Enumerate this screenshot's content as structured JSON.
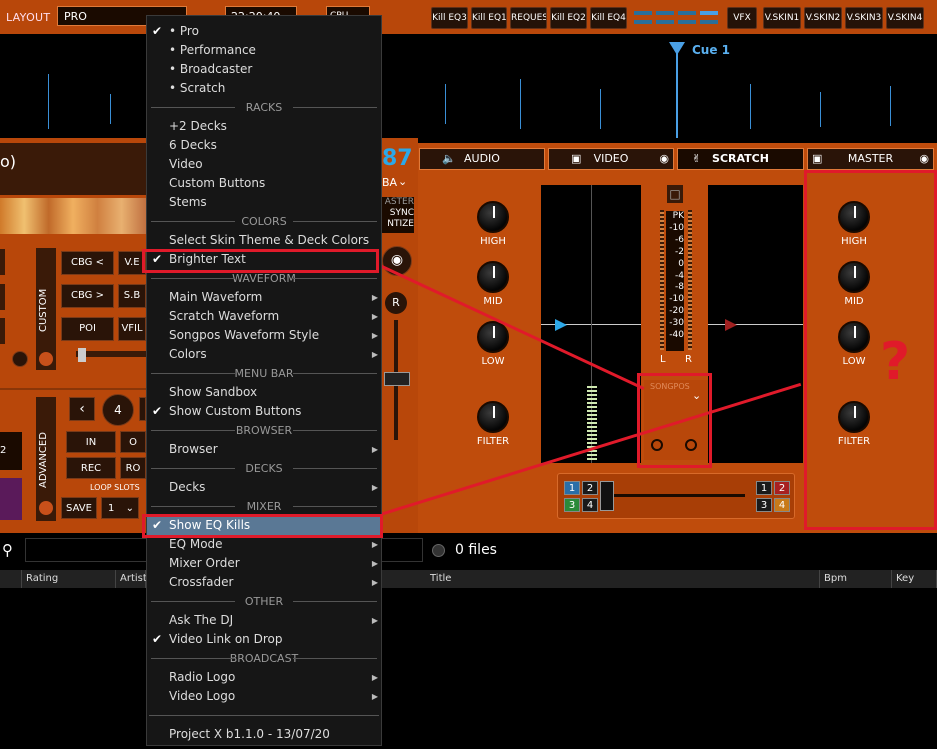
{
  "topbar": {
    "layout_label": "LAYOUT",
    "layout_value": "PRO",
    "clock": "22:20:40",
    "cpu_label": "CPU",
    "buttons": [
      "Kill EQ3",
      "Kill EQ1",
      "REQUEST",
      "Kill EQ2",
      "Kill EQ4",
      "VFX",
      "V.SKIN1",
      "V.SKIN2",
      "V.SKIN3",
      "V.SKIN4"
    ]
  },
  "waveform": {
    "cue_label": "Cue 1"
  },
  "deck": {
    "title_fragment": "o)",
    "bpm_fragment": "87",
    "key_fragment": "BA",
    "sync_label": "SYNC",
    "quantize_fragment": "NTIZE",
    "master_fragment": "ASTER",
    "custom_label": "CUSTOM",
    "advanced_label": "ADVANCED",
    "pad_buttons": [
      "CBG <",
      "V.E",
      "CBG >",
      "S.B",
      "POI",
      "VFIL"
    ],
    "loop_value": "4",
    "adv_buttons": [
      "IN",
      "O",
      "REC",
      "RO"
    ],
    "loop_slots_label": "LOOP SLOTS",
    "save_label": "SAVE",
    "slot_value": "1",
    "r_label": "R",
    "side_num": "2"
  },
  "mixer": {
    "tabs": [
      "AUDIO",
      "VIDEO",
      "SCRATCH",
      "MASTER"
    ],
    "left_knobs": [
      "HIGH",
      "MID",
      "LOW",
      "FILTER"
    ],
    "right_knobs": [
      "HIGH",
      "MID",
      "LOW",
      "FILTER"
    ],
    "vu_scale": [
      "PK",
      "-10",
      "-6",
      "-2",
      "0",
      "-4",
      "-8",
      "-10",
      "-20",
      "-30",
      "-40"
    ],
    "lr": [
      "L",
      "R"
    ],
    "sonogram_label": "SONGPOS",
    "pads_left": [
      "1",
      "2",
      "3",
      "4"
    ],
    "pads_right": [
      "1",
      "2",
      "3",
      "4"
    ],
    "question_mark": "?"
  },
  "browser": {
    "files_count": "0 files",
    "columns": [
      "Rating",
      "Artist",
      "Title",
      "Bpm",
      "Key"
    ]
  },
  "menu": {
    "items": [
      {
        "type": "item",
        "label": "• Pro",
        "check": true
      },
      {
        "type": "item",
        "label": "• Performance"
      },
      {
        "type": "item",
        "label": "• Broadcaster"
      },
      {
        "type": "item",
        "label": "• Scratch"
      },
      {
        "type": "section",
        "label": "RACKS"
      },
      {
        "type": "item",
        "label": "+2 Decks"
      },
      {
        "type": "item",
        "label": "6 Decks"
      },
      {
        "type": "item",
        "label": "Video"
      },
      {
        "type": "item",
        "label": "Custom Buttons"
      },
      {
        "type": "item",
        "label": "Stems"
      },
      {
        "type": "section",
        "label": "COLORS"
      },
      {
        "type": "item",
        "label": "Select Skin Theme & Deck Colors"
      },
      {
        "type": "item",
        "label": "Brighter Text",
        "check": true
      },
      {
        "type": "section",
        "label": "WAVEFORM"
      },
      {
        "type": "item",
        "label": "Main Waveform",
        "arrow": true
      },
      {
        "type": "item",
        "label": "Scratch Waveform",
        "arrow": true
      },
      {
        "type": "item",
        "label": "Songpos Waveform Style",
        "arrow": true
      },
      {
        "type": "item",
        "label": "Colors",
        "arrow": true
      },
      {
        "type": "section",
        "label": "MENU BAR"
      },
      {
        "type": "item",
        "label": "Show Sandbox"
      },
      {
        "type": "item",
        "label": "Show Custom Buttons",
        "check": true
      },
      {
        "type": "section",
        "label": "BROWSER"
      },
      {
        "type": "item",
        "label": "Browser",
        "arrow": true
      },
      {
        "type": "section",
        "label": "DECKS"
      },
      {
        "type": "item",
        "label": "Decks",
        "arrow": true
      },
      {
        "type": "section",
        "label": "MIXER"
      },
      {
        "type": "item",
        "label": "Show EQ Kills",
        "check": true,
        "highlight": true
      },
      {
        "type": "item",
        "label": "EQ Mode",
        "arrow": true
      },
      {
        "type": "item",
        "label": "Mixer Order",
        "arrow": true
      },
      {
        "type": "item",
        "label": "Crossfader",
        "arrow": true
      },
      {
        "type": "section",
        "label": "OTHER"
      },
      {
        "type": "item",
        "label": "Ask The DJ",
        "arrow": true
      },
      {
        "type": "item",
        "label": "Video Link on Drop",
        "check": true
      },
      {
        "type": "section",
        "label": "BROADCAST"
      },
      {
        "type": "item",
        "label": "Radio Logo",
        "arrow": true
      },
      {
        "type": "item",
        "label": "Video Logo",
        "arrow": true
      },
      {
        "type": "separator"
      },
      {
        "type": "item",
        "label": "Project X b1.1.0 - 13/07/20"
      }
    ]
  },
  "colors": {
    "accent": "#b8470a",
    "highlight": "#e01a2a",
    "menu_hl": "#5a7895"
  }
}
